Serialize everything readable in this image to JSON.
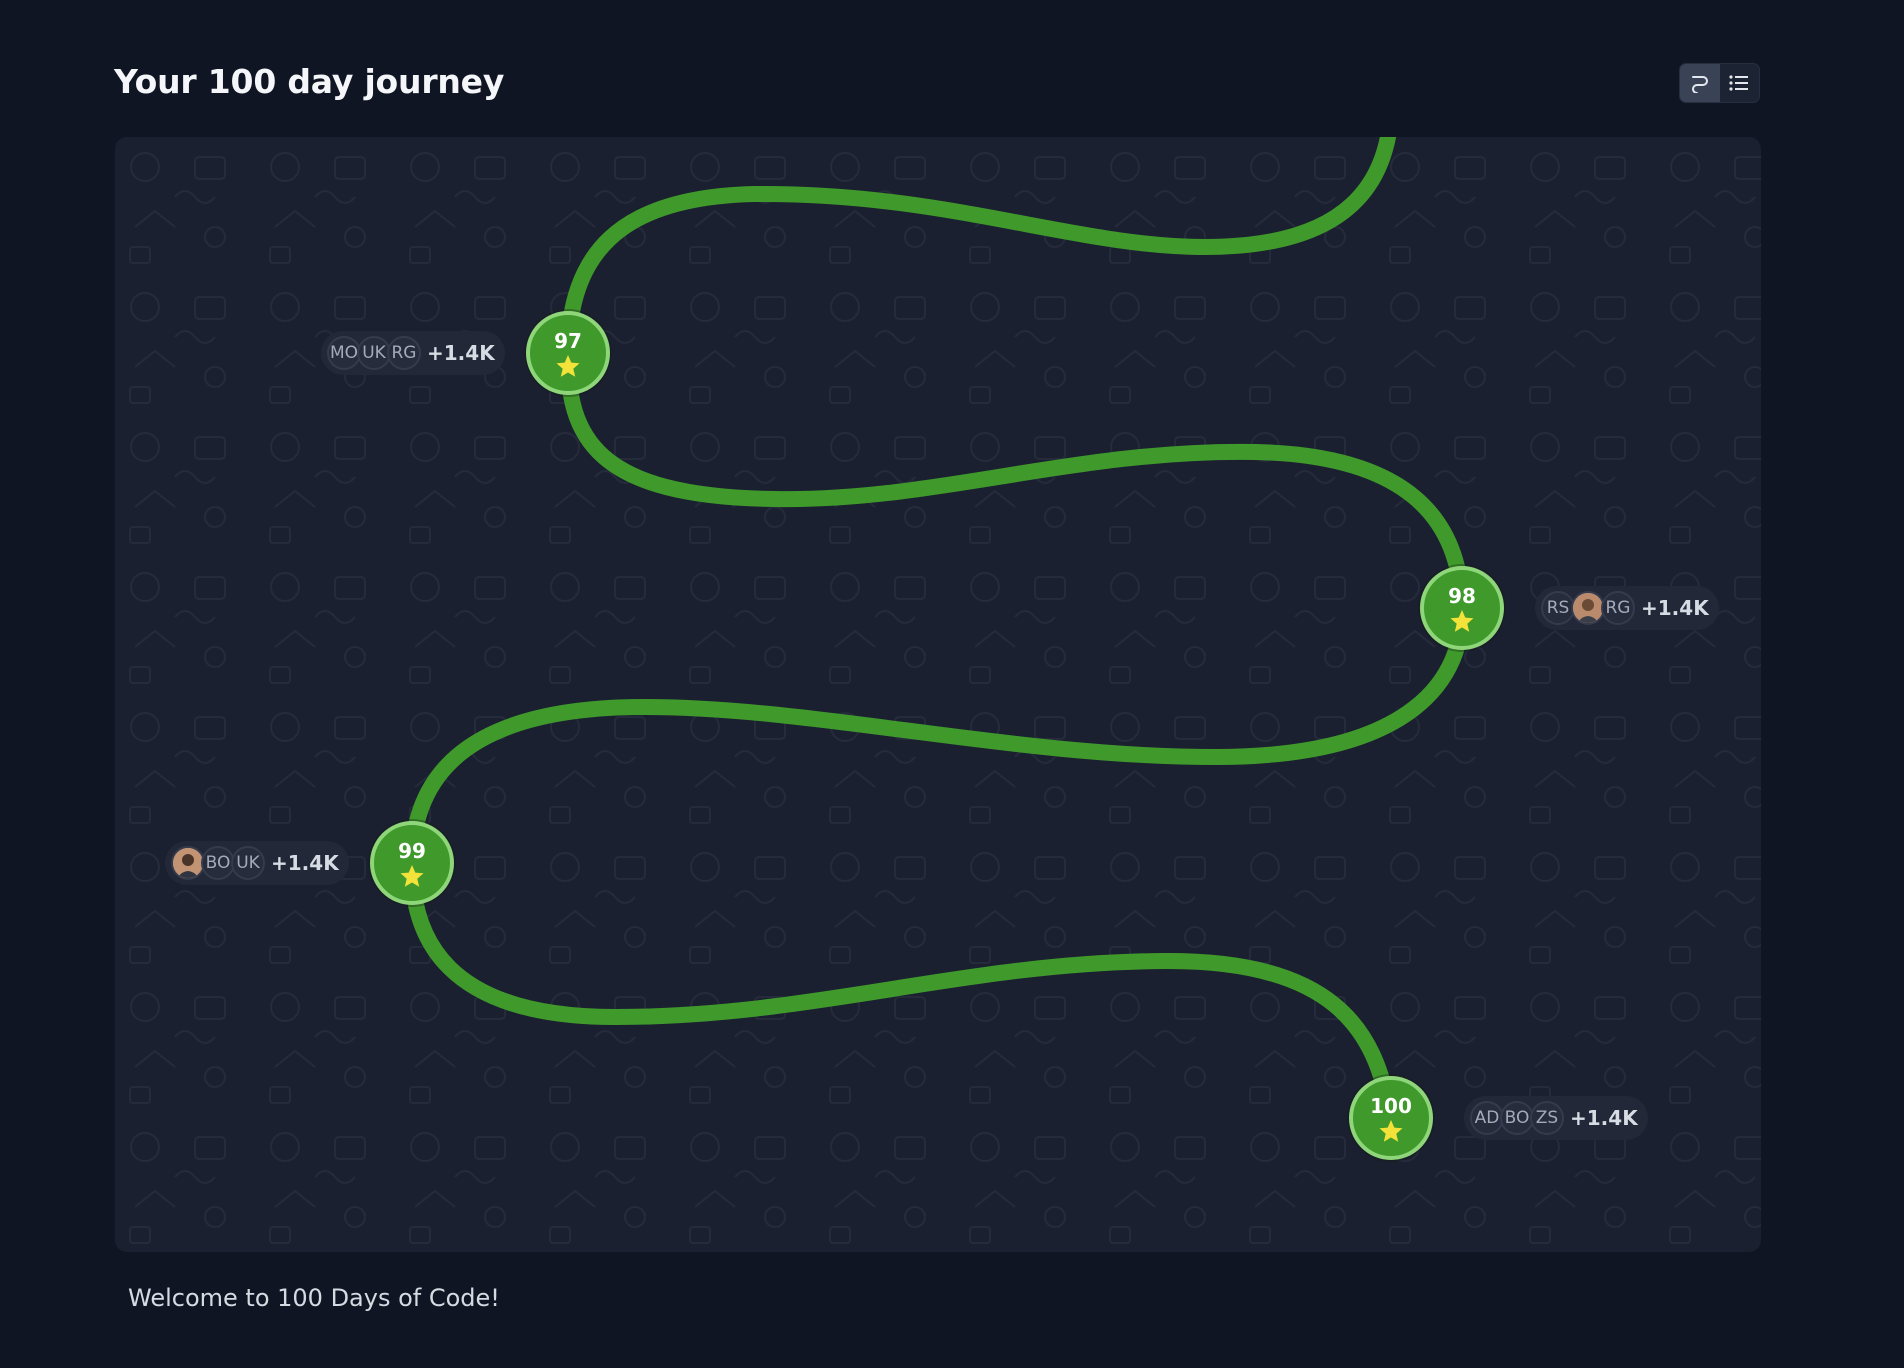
{
  "header": {
    "title": "Your 100 day journey"
  },
  "view_toggle": {
    "options": [
      {
        "name": "path-view",
        "icon": "path-icon",
        "active": true
      },
      {
        "name": "list-view",
        "icon": "list-icon",
        "active": false
      }
    ]
  },
  "journey": {
    "path_color": "#3f9a2b",
    "nodes": [
      {
        "day": "97",
        "icon": "star-icon",
        "participants": [
          "MO",
          "UK",
          "RG"
        ],
        "extra_count": "+1.4K"
      },
      {
        "day": "98",
        "icon": "star-icon",
        "participants": [
          "RS",
          "photo",
          "RG"
        ],
        "extra_count": "+1.4K"
      },
      {
        "day": "99",
        "icon": "star-icon",
        "participants": [
          "photo",
          "BO",
          "UK"
        ],
        "extra_count": "+1.4K"
      },
      {
        "day": "100",
        "icon": "star-icon",
        "participants": [
          "AD",
          "BO",
          "ZS"
        ],
        "extra_count": "+1.4K"
      }
    ]
  },
  "footer": {
    "welcome": "Welcome to 100 Days of Code!"
  }
}
